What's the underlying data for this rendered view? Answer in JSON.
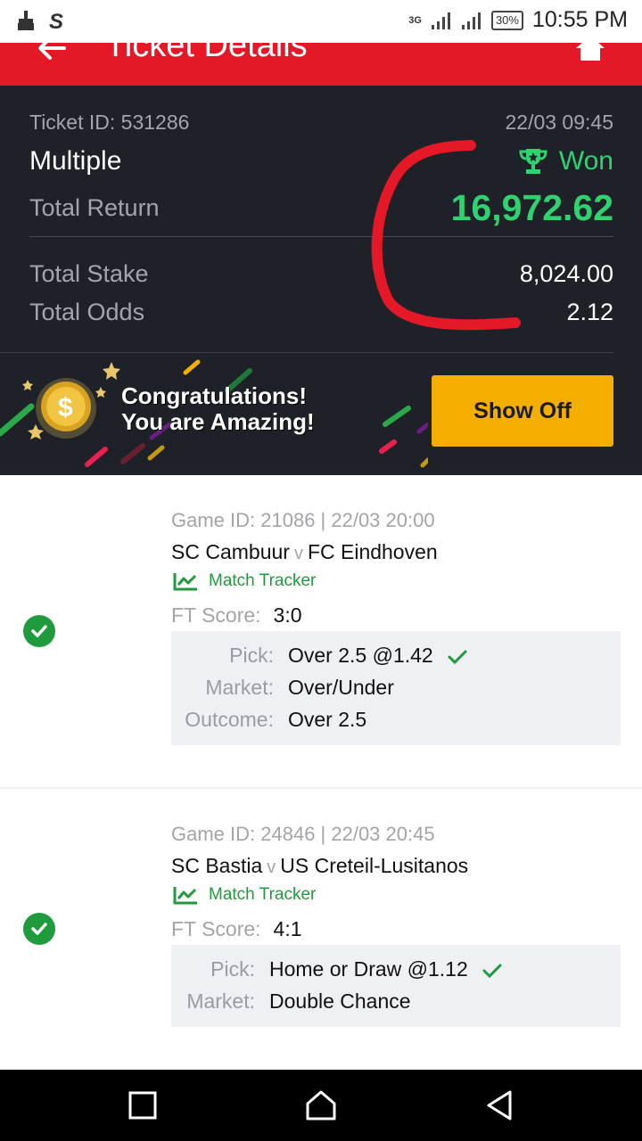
{
  "status_bar": {
    "time": "10:55 PM",
    "battery": "30%",
    "network": "3G"
  },
  "header": {
    "title": "Ticket Details"
  },
  "summary": {
    "ticket_id": "Ticket ID: 531286",
    "date": "22/03 09:45",
    "bet_type": "Multiple",
    "status": "Won",
    "total_return_label": "Total Return",
    "total_return": "16,972.62",
    "total_stake_label": "Total Stake",
    "total_stake": "8,024.00",
    "total_odds_label": "Total Odds",
    "total_odds": "2.12"
  },
  "banner": {
    "line1": "Congratulations!",
    "line2": "You are Amazing!",
    "button": "Show Off"
  },
  "games": [
    {
      "meta": "Game ID: 21086 | 22/03 20:00",
      "home": "SC Cambuur",
      "vs": "v",
      "away": "FC Eindhoven",
      "tracker": "Match Tracker",
      "score_label": "FT Score:",
      "score": "3:0",
      "pick_label": "Pick:",
      "pick": "Over 2.5 @1.42",
      "market_label": "Market:",
      "market": "Over/Under",
      "outcome_label": "Outcome:",
      "outcome": "Over 2.5"
    },
    {
      "meta": "Game ID: 24846 | 22/03 20:45",
      "home": "SC Bastia",
      "vs": "v",
      "away": "US Creteil-Lusitanos",
      "tracker": "Match Tracker",
      "score_label": "FT Score:",
      "score": "4:1",
      "pick_label": "Pick:",
      "pick": "Home or Draw @1.12",
      "market_label": "Market:",
      "market": "Double Chance"
    }
  ],
  "colors": {
    "brand_red": "#e41827",
    "win_green": "#2fd26e",
    "check_green": "#1f9a3d",
    "button_yellow": "#f4ae00",
    "dark_bg": "#1f2129"
  }
}
